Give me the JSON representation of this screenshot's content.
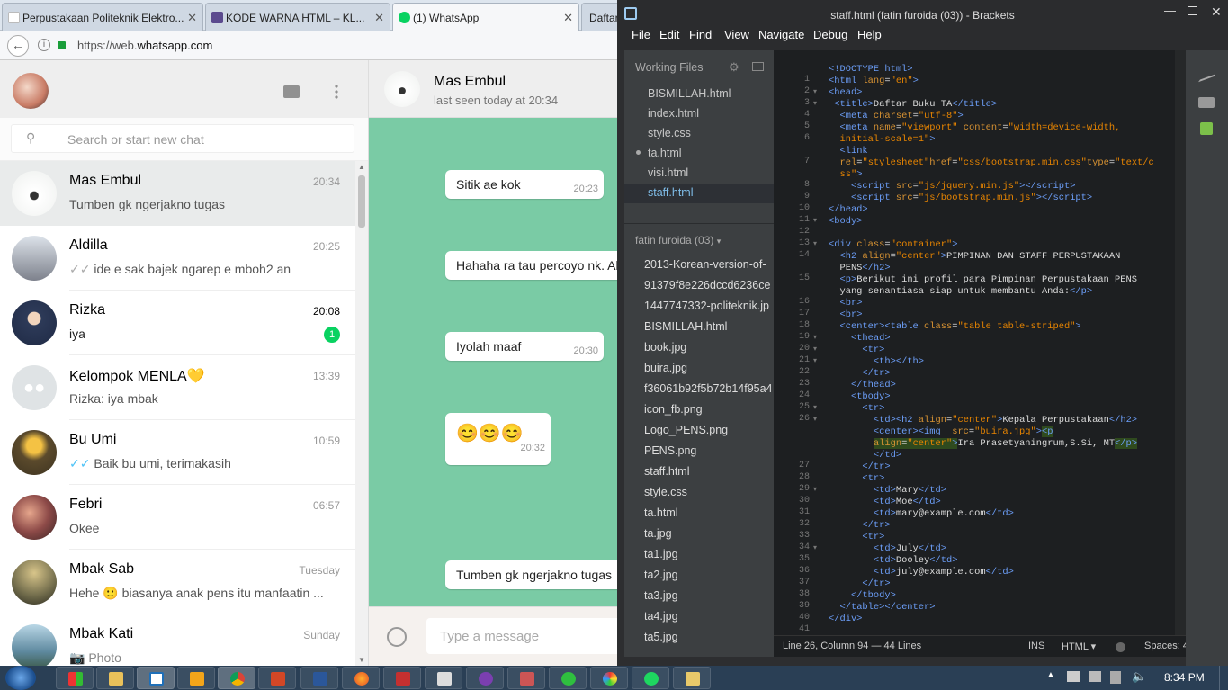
{
  "browser": {
    "tabs": [
      {
        "label": "Perpustakaan Politeknik Elektro..."
      },
      {
        "label": "KODE WARNA HTML – KL..."
      },
      {
        "label": "(1) WhatsApp"
      },
      {
        "label": "Daftar"
      }
    ],
    "url_prefix": "https://web.",
    "url_domain": "whatsapp.com",
    "colors": {
      "tabstrip": "#dde5ee",
      "active_tab": "#f6f7f9"
    }
  },
  "whatsapp": {
    "search_placeholder": "Search or start new chat",
    "active_chat": {
      "name": "Mas Embul",
      "status": "last seen today at 20:34"
    },
    "chats": [
      {
        "name": "Mas Embul",
        "time": "20:34",
        "preview": "Tumben gk ngerjakno tugas",
        "avatar": "#8ea07a"
      },
      {
        "name": "Aldilla",
        "time": "20:25",
        "ticks": "✓✓",
        "preview": "ide e sak bajek ngarep e mboh2 an",
        "avatar": "#6a6f7c"
      },
      {
        "name": "Rizka",
        "time": "20:08",
        "preview": "iya",
        "unread": "1",
        "avatar": "#3b4a66"
      },
      {
        "name": "Kelompok MENLA💛",
        "time": "13:39",
        "preview": "Rizka: iya mbak",
        "avatar": "#dfe3e5"
      },
      {
        "name": "Bu Umi",
        "time": "10:59",
        "ticks": "✓✓",
        "preview": "Baik bu umi, terimakasih",
        "avatar": "#6b5a35"
      },
      {
        "name": "Febri",
        "time": "06:57",
        "preview": "Okee",
        "avatar": "#8d4a48"
      },
      {
        "name": "Mbak Sab",
        "time": "Tuesday",
        "preview": "Hehe 🙂 biasanya anak pens itu manfaatin ...",
        "avatar": "#6f6a4a"
      },
      {
        "name": "Mbak Kati",
        "time": "Sunday",
        "preview": "📷 Photo",
        "avatar": "#5f8aa0"
      }
    ],
    "messages": [
      {
        "text": "Sitik ae kok",
        "time": "20:23"
      },
      {
        "text": "Hahaha ra tau percoyo nk. Al",
        "time": ""
      },
      {
        "text": "Iyolah maaf",
        "time": "20:30"
      },
      {
        "text": "😊😊😊",
        "time": "20:32"
      },
      {
        "text": "Tumben gk ngerjakno tugas",
        "time": ""
      }
    ],
    "input_placeholder": "Type a message",
    "colors": {
      "background": "#7acba5",
      "unread_badge": "#09d261"
    }
  },
  "brackets": {
    "title": "staff.html (fatin furoida (03)) - Brackets",
    "menu": [
      "File",
      "Edit",
      "Find",
      "View",
      "Navigate",
      "Debug",
      "Help"
    ],
    "working_files_label": "Working Files",
    "working_files": [
      "BISMILLAH.html",
      "index.html",
      "style.css",
      "ta.html",
      "visi.html",
      "staff.html"
    ],
    "project_label": "fatin furoida (03)",
    "project_files": [
      "2013-Korean-version-of-",
      "91379f8e226dccd6236ce",
      "1447747332-politeknik.jp",
      "BISMILLAH.html",
      "book.jpg",
      "buira.jpg",
      "f36061b92f5b72b14f95a4",
      "icon_fb.png",
      "Logo_PENS.png",
      "PENS.png",
      "staff.html",
      "style.css",
      "ta.html",
      "ta.jpg",
      "ta1.jpg",
      "ta2.jpg",
      "ta3.jpg",
      "ta4.jpg",
      "ta5.jpg"
    ],
    "line_numbers": [
      "1",
      "2",
      "3",
      "4",
      "5",
      "6",
      "",
      "7",
      "",
      "8",
      "9",
      "10",
      "11",
      "12",
      "13",
      "14",
      "",
      "15",
      "",
      "16",
      "17",
      "18",
      "19",
      "20",
      "21",
      "22",
      "23",
      "24",
      "25",
      "26",
      "",
      "",
      "",
      "27",
      "28",
      "29",
      "30",
      "31",
      "32",
      "33",
      "34",
      "35",
      "36",
      "37",
      "38",
      "39",
      "40",
      "41"
    ],
    "status": {
      "position": "Line 26, Column 94",
      "lines": "44 Lines",
      "mode": "INS",
      "language": "HTML",
      "spaces": "Spaces: 4"
    }
  },
  "taskbar": {
    "clock": "8:34 PM"
  }
}
